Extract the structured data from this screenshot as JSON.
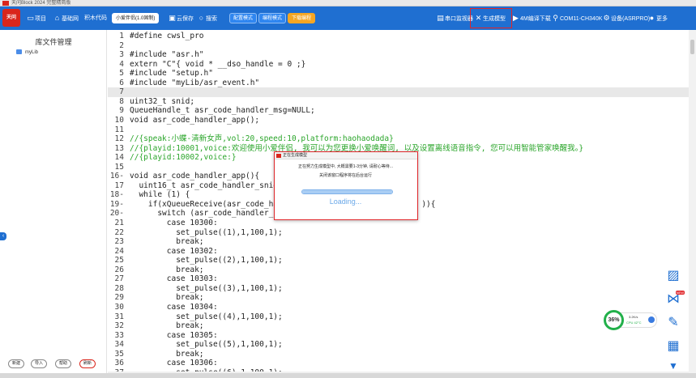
{
  "window": {
    "title": "天问Block 2024 完整精简版"
  },
  "toolbar": {
    "logo_text": "天问",
    "project": "项目",
    "base_map": "基础网",
    "block_code": "积木代码",
    "board": "小爱伴侣(1.0固制)",
    "save": "云保存",
    "search": "搜索",
    "config_mode": "配置模式",
    "code_mode": "编程模式",
    "hint_mode": "下载编程",
    "serial_monitor": "串口监视器",
    "generate_model": "生成模型",
    "download_4m": "4M编译下载",
    "com_port": "COM11-CH340K",
    "device": "设备(ASRPRO)",
    "more": "更多"
  },
  "sidebar": {
    "title": "库文件管理",
    "folder": "myLib",
    "buttons": [
      "新建",
      "导入",
      "帮助",
      "刷新"
    ]
  },
  "editor": {
    "lines": [
      {
        "n": "1",
        "text": "#define cwsl_pro",
        "cls": ""
      },
      {
        "n": "2",
        "text": "",
        "cls": ""
      },
      {
        "n": "3",
        "text": "#include \"asr.h\"",
        "cls": ""
      },
      {
        "n": "4",
        "text": "extern \"C\"{ void * __dso_handle = 0 ;}",
        "cls": ""
      },
      {
        "n": "5",
        "text": "#include \"setup.h\"",
        "cls": ""
      },
      {
        "n": "6",
        "text": "#include \"myLib/asr_event.h\"",
        "cls": ""
      },
      {
        "n": "7",
        "text": "",
        "cls": ""
      },
      {
        "n": "8",
        "text": "uint32_t snid;",
        "cls": ""
      },
      {
        "n": "9",
        "text": "QueueHandle_t asr_code_handler_msg=NULL;",
        "cls": ""
      },
      {
        "n": "10",
        "text": "void asr_code_handler_app();",
        "cls": ""
      },
      {
        "n": "11",
        "text": "",
        "cls": ""
      },
      {
        "n": "12",
        "text": "//{speak:小蝶-清新女声,vol:20,speed:10,platform:haohaodada}",
        "cls": "cmt"
      },
      {
        "n": "13",
        "text": "//{playid:10001,voice:欢迎使用小爱伴侣, 我可以为您更换小爱唤醒词, 以及设置离线语音指令, 您可以用智能管家唤醒我。}",
        "cls": "cmt"
      },
      {
        "n": "14",
        "text": "//{playid:10002,voice:}",
        "cls": "cmt"
      },
      {
        "n": "15",
        "text": "",
        "cls": ""
      },
      {
        "n": "16-",
        "text": "void asr_code_handler_app(){",
        "cls": ""
      },
      {
        "n": "17",
        "text": "  uint16_t asr_code_handler_snid;",
        "cls": ""
      },
      {
        "n": "18-",
        "text": "  while (1) {",
        "cls": ""
      },
      {
        "n": "19-",
        "text": "    if(xQueueReceive(asr_code_han                              )){",
        "cls": ""
      },
      {
        "n": "20-",
        "text": "      switch (asr_code_handler_sn",
        "cls": ""
      },
      {
        "n": "21",
        "text": "        case 10300:",
        "cls": ""
      },
      {
        "n": "22",
        "text": "          set_pulse((1),1,100,1);",
        "cls": ""
      },
      {
        "n": "23",
        "text": "          break;",
        "cls": ""
      },
      {
        "n": "24",
        "text": "        case 10302:",
        "cls": ""
      },
      {
        "n": "25",
        "text": "          set_pulse((2),1,100,1);",
        "cls": ""
      },
      {
        "n": "26",
        "text": "          break;",
        "cls": ""
      },
      {
        "n": "27",
        "text": "        case 10303:",
        "cls": ""
      },
      {
        "n": "28",
        "text": "          set_pulse((3),1,100,1);",
        "cls": ""
      },
      {
        "n": "29",
        "text": "          break;",
        "cls": ""
      },
      {
        "n": "30",
        "text": "        case 10304:",
        "cls": ""
      },
      {
        "n": "31",
        "text": "          set_pulse((4),1,100,1);",
        "cls": ""
      },
      {
        "n": "32",
        "text": "          break;",
        "cls": ""
      },
      {
        "n": "33",
        "text": "        case 10305:",
        "cls": ""
      },
      {
        "n": "34",
        "text": "          set_pulse((5),1,100,1);",
        "cls": ""
      },
      {
        "n": "35",
        "text": "          break;",
        "cls": ""
      },
      {
        "n": "36",
        "text": "        case 10306:",
        "cls": ""
      },
      {
        "n": "37",
        "text": "          set_pulse((6),1,100,1);",
        "cls": ""
      }
    ]
  },
  "dialog": {
    "title": "正在生成模型",
    "message": "正在努力生成模型中, 大概需要1-3分钟, 请耐心等待...",
    "note": "关闭该窗口程序将在后台运行",
    "loading": "Loading..."
  },
  "perf": {
    "percent": "36%",
    "net": "3.2K/s",
    "cpu": "CPU 42°C"
  },
  "float_tools": {
    "badge": "NEW"
  }
}
